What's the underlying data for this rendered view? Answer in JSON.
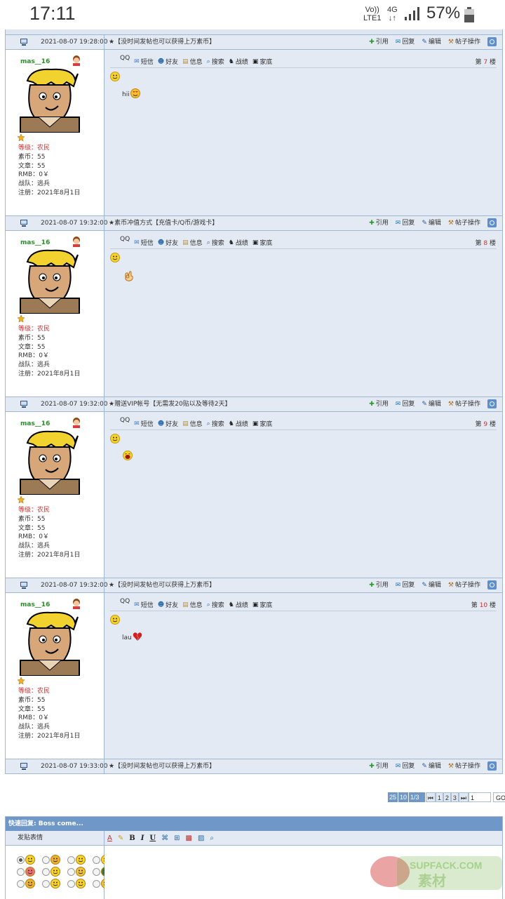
{
  "status_bar": {
    "time": "17:11",
    "volte": "Vo))",
    "lte": "LTE1",
    "network": "4G",
    "battery": "57%"
  },
  "posts": [
    {
      "username": "mas__16",
      "rank": "等级：农民",
      "coins": "素币：55",
      "articles": "文章：55",
      "rmb": "RMB：0￥",
      "team": "战队：逃兵",
      "registered": "注册：2021年8月1日",
      "floor_prefix": "第",
      "floor_num": "7",
      "floor_suffix": "楼",
      "message_text": "hii",
      "message_emoji": "love",
      "date": "2021-08-07 19:32:00",
      "notice": "★素币冲值方式【充值卡/Q币/游戏卡】"
    },
    {
      "username": "mas__16",
      "rank": "等级：农民",
      "coins": "素币：55",
      "articles": "文章：55",
      "rmb": "RMB：0￥",
      "team": "战队：逃兵",
      "registered": "注册：2021年8月1日",
      "floor_prefix": "第",
      "floor_num": "8",
      "floor_suffix": "楼",
      "message_text": "",
      "message_emoji": "ok-hand",
      "date": "2021-08-07 19:32:00",
      "notice": "★赠送VIP帐号【无需发20贴以及等待2天】"
    },
    {
      "username": "mas__16",
      "rank": "等级：农民",
      "coins": "素币：55",
      "articles": "文章：55",
      "rmb": "RMB：0￥",
      "team": "战队：逃兵",
      "registered": "注册：2021年8月1日",
      "floor_prefix": "第",
      "floor_num": "9",
      "floor_suffix": "楼",
      "message_text": "",
      "message_emoji": "laugh",
      "date": "2021-08-07 19:32:00",
      "notice": "★【没时间发帖也可以获得上万素币】"
    },
    {
      "username": "mas__16",
      "rank": "等级：农民",
      "coins": "素币：55",
      "articles": "文章：55",
      "rmb": "RMB：0￥",
      "team": "战队：逃兵",
      "registered": "注册：2021年8月1日",
      "floor_prefix": "第",
      "floor_num": "10",
      "floor_suffix": "楼",
      "message_text": "lau",
      "message_emoji": "broken-heart",
      "date": "2021-08-07 19:33:00",
      "notice": "★【没时间发帖也可以获得上万素币】"
    }
  ],
  "first_meta": {
    "date": "2021-08-07 19:28:00",
    "notice": "★【没时间发帖也可以获得上万素币】"
  },
  "actions": {
    "quote": "引用",
    "reply": "回复",
    "edit": "编辑",
    "post_ops": "帖子操作"
  },
  "user_toolbar": {
    "qq": "QQ",
    "sms": "短信",
    "friend": "好友",
    "info": "信息",
    "search": "搜索",
    "battle": "战绩",
    "home": "家底"
  },
  "pager": {
    "per_page_1": "25",
    "per_page_2": "10",
    "page_info": "1/3页",
    "first": "⏮",
    "p1": "1",
    "p2": "2",
    "p3": "3",
    "last": "⏭",
    "input_value": "1",
    "go": "GO"
  },
  "quick_reply": {
    "title": "快速回复: Boss come...",
    "emoticon_label": "发贴表情",
    "editor_buttons": {
      "bold": "B",
      "italic": "I",
      "underline": "U"
    }
  },
  "watermark": "SUPFACK.COM",
  "colors": {
    "header_blue": "#6f97c8",
    "border": "#9fb7d0",
    "content_bg": "#e3eaf3",
    "username_green": "#2c8c2c",
    "rank_red": "#d03030"
  }
}
